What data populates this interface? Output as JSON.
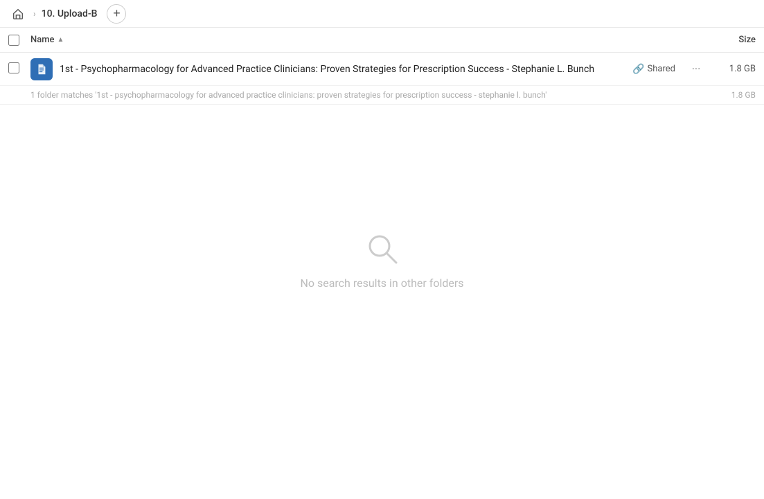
{
  "breadcrumb": {
    "home_label": "Home",
    "folder_name": "10. Upload-B",
    "add_btn_label": "+"
  },
  "columns": {
    "name_label": "Name",
    "size_label": "Size"
  },
  "file_row": {
    "name": "1st - Psychopharmacology for Advanced Practice Clinicians: Proven Strategies for Prescription Success - Stephanie L. Bunch",
    "shared_label": "Shared",
    "size": "1.8 GB",
    "more_icon": "···"
  },
  "summary_row": {
    "text": "1 folder matches '1st - psychopharmacology for advanced practice clinicians: proven strategies for prescription success - stephanie l. bunch'",
    "size": "1.8 GB"
  },
  "empty_state": {
    "label": "No search results in other folders"
  }
}
